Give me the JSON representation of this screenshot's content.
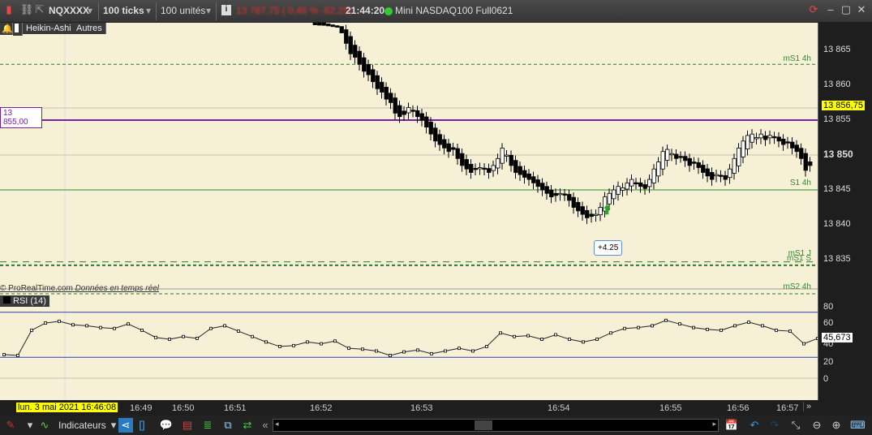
{
  "topbar": {
    "symbol": "NQXXXX",
    "ticks": "100 ticks",
    "units": "100 unités",
    "quote": "13 787,75 ( 0,46 % -62,25)",
    "time": "21:44:20",
    "instrument": "Mini NASDAQ100 Full0621",
    "quote_color": "#e03030"
  },
  "chart_tags": {
    "type": "Heikin-Ashi",
    "other": "Autres",
    "copyright": "© ProRealTime.com",
    "realtime": "Données en temps réel",
    "rsi": "RSI (14)"
  },
  "levels": {
    "purple": "13 855,00",
    "ms1_4h": "mS1 4h",
    "s1_4h": "S1 4h",
    "ms1_j": "mS1 J",
    "ms1_s": "mS1 S",
    "ms2_4h": "mS2 4h",
    "annotation": "+4.25"
  },
  "price_axis": {
    "labels": [
      "13 865",
      "13 860",
      "13 855",
      "13 850",
      "13 845",
      "13 840",
      "13 835"
    ],
    "current": "13 856,75"
  },
  "rsi_axis": {
    "labels": [
      "80",
      "60",
      "40",
      "20",
      "0"
    ],
    "current": "45,673"
  },
  "time_axis": {
    "cursor": "lun. 3 mai 2021 16:46:08",
    "labels": [
      "16:49",
      "16:50",
      "16:51",
      "16:52",
      "16:53",
      "16:54",
      "16:55",
      "16:56",
      "16:57"
    ],
    "more": "»"
  },
  "toolbar": {
    "indicators": "Indicateurs"
  },
  "chart_data": [
    {
      "type": "candlestick",
      "style": "Heikin-Ashi",
      "ylim": [
        13831,
        13868.5
      ],
      "closes": [
        13869,
        13868.8,
        13868.6,
        13868.5,
        13868.4,
        13868.3,
        13867.5,
        13866,
        13864.5,
        13864,
        13863,
        13862,
        13861.5,
        13860.5,
        13859.5,
        13859,
        13858,
        13857.5,
        13856,
        13855.5,
        13855.8,
        13856.8,
        13856.3,
        13855.5,
        13855,
        13854,
        13853,
        13852,
        13851.5,
        13851,
        13850.5,
        13850.8,
        13849.5,
        13848.5,
        13848,
        13847.5,
        13848,
        13848.2,
        13848,
        13847.5,
        13848.5,
        13849.5,
        13851,
        13850,
        13848.5,
        13847.5,
        13847.2,
        13846.8,
        13846.5,
        13846,
        13845.5,
        13845,
        13844.5,
        13844,
        13844.2,
        13844.5,
        13844.3,
        13843.5,
        13842.5,
        13842,
        13841.5,
        13841,
        13841.2,
        13841.5,
        13842.5,
        13844,
        13844.5,
        13845,
        13845.5,
        13845.3,
        13846,
        13846.5,
        13846,
        13845.5,
        13845.2,
        13846.5,
        13848,
        13849,
        13850.5,
        13850.8,
        13850.2,
        13849.5,
        13849.8,
        13849.2,
        13848.5,
        13848.8,
        13848.2,
        13847.5,
        13847,
        13846.5,
        13847.2,
        13847,
        13846.5,
        13848,
        13849.5,
        13851,
        13852,
        13852.8,
        13853,
        13852.5,
        13853,
        13852.2,
        13852.8,
        13852.5,
        13852,
        13851.5,
        13851.8,
        13851,
        13850.5,
        13849.5,
        13847.8,
        13848.5
      ],
      "horizontal_levels": {
        "purple": 13855,
        "ms1_4h": 13863,
        "s1_4h": 13845,
        "ms1_j": 13834.7,
        "ms1_s": 13834.2,
        "ms2_4h": 13830,
        "gray": [
          13856.75,
          13850
        ]
      }
    },
    {
      "type": "line",
      "title": "RSI (14)",
      "ylim": [
        0,
        80
      ],
      "levels": [
        75,
        25
      ],
      "values": [
        28,
        27,
        55,
        63,
        65,
        61,
        60,
        58,
        57,
        62,
        55,
        47,
        45,
        48,
        46,
        57,
        60,
        54,
        48,
        42,
        37,
        38,
        42,
        40,
        43,
        35,
        34,
        32,
        27,
        31,
        33,
        29,
        32,
        35,
        32,
        37,
        52,
        48,
        49,
        45,
        50,
        45,
        42,
        45,
        52,
        57,
        58,
        60,
        66,
        62,
        58,
        56,
        55,
        60,
        64,
        60,
        55,
        54,
        40,
        46
      ]
    }
  ]
}
